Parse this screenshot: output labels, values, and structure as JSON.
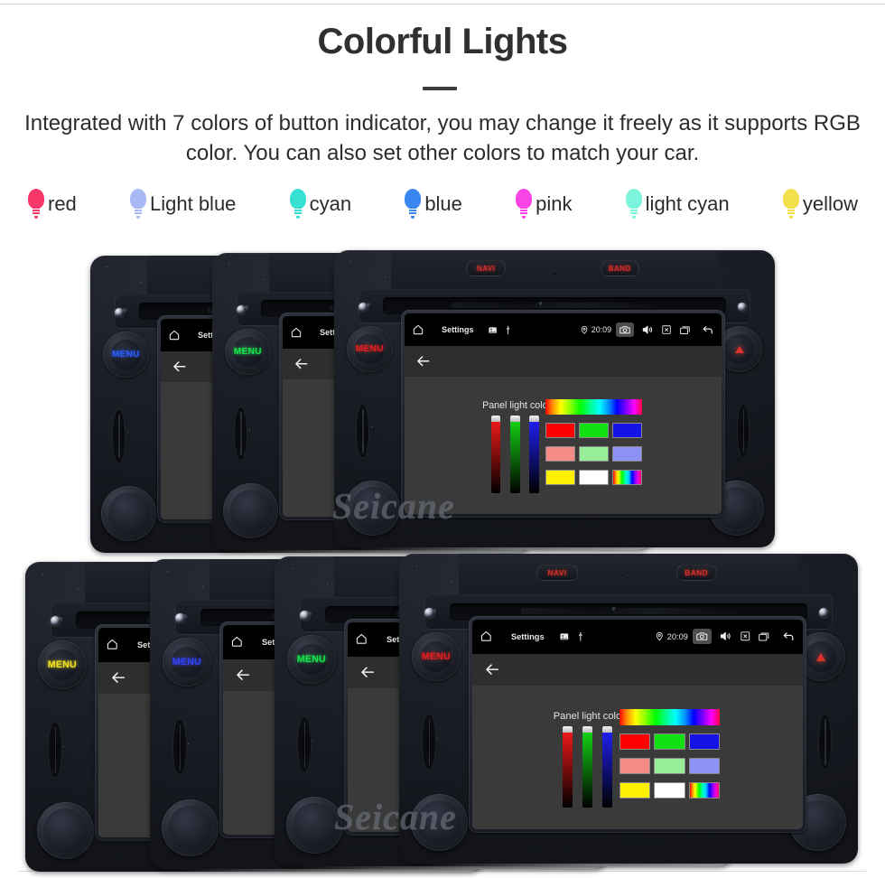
{
  "header": {
    "title": "Colorful Lights",
    "subtitle": "Integrated with 7 colors of button indicator, you may change it freely as it supports RGB color. You can also set other colors to match your car.",
    "divider_color": "#3c3d3f",
    "title_color": "#2f3032"
  },
  "legend": {
    "items": [
      {
        "label": "red",
        "color": "#f7386a"
      },
      {
        "label": "Light blue",
        "color": "#a7b9f4"
      },
      {
        "label": "cyan",
        "color": "#36e0d2"
      },
      {
        "label": "blue",
        "color": "#3a86f0"
      },
      {
        "label": "pink",
        "color": "#f945e6"
      },
      {
        "label": "light cyan",
        "color": "#7df4dc"
      },
      {
        "label": "yellow",
        "color": "#f2e04a"
      }
    ]
  },
  "device": {
    "brand_watermark": "Seicane",
    "front_buttons": {
      "navi": "NAVI",
      "band": "BAND"
    },
    "menu_knob_label": "MENU",
    "hazard_icon": "hazard-triangle-icon",
    "screen": {
      "statusbar": {
        "home_icon": "home-icon",
        "title": "Settings",
        "gallery_icon": "gallery-icon",
        "usb_icon": "usb-icon",
        "location_icon": "location-pin-icon",
        "time": "20:09",
        "camera_icon": "camera-icon",
        "volume_icon": "volume-icon",
        "close_icon": "close-box-icon",
        "recents_icon": "recents-icon",
        "back_icon": "back-arrow-icon"
      },
      "actionbar": {
        "back_icon": "back-arrow-icon"
      },
      "panel": {
        "label": "Panel light color",
        "sliders": [
          {
            "name": "red-slider",
            "color": "#ff1a1a",
            "value": 100
          },
          {
            "name": "green-slider",
            "color": "#15e015",
            "value": 100
          },
          {
            "name": "blue-slider",
            "color": "#2222ff",
            "value": 100
          }
        ],
        "hue_bar": "hue-gradient",
        "swatches": [
          [
            {
              "name": "red",
              "color": "#ff0000"
            },
            {
              "name": "green",
              "color": "#12e012"
            },
            {
              "name": "blue",
              "color": "#1414e8"
            }
          ],
          [
            {
              "name": "salmon",
              "color": "#f58b85"
            },
            {
              "name": "light-green",
              "color": "#97ee97"
            },
            {
              "name": "periwinkle",
              "color": "#8f92f5"
            }
          ],
          [
            {
              "name": "yellow",
              "color": "#ffef00"
            },
            {
              "name": "white",
              "color": "#ffffff"
            },
            {
              "name": "rainbow",
              "color": "rainbow"
            }
          ]
        ]
      }
    }
  },
  "rows": [
    {
      "name": "top-row",
      "units": [
        {
          "name": "unit-1",
          "menu_color": "#2b5bf5"
        },
        {
          "name": "unit-2",
          "menu_color": "#18e04a"
        },
        {
          "name": "unit-3",
          "menu_color": "#e02020"
        }
      ]
    },
    {
      "name": "bottom-row",
      "units": [
        {
          "name": "unit-1",
          "menu_color": "#f0e020"
        },
        {
          "name": "unit-2",
          "menu_color": "#3340f5"
        },
        {
          "name": "unit-3",
          "menu_color": "#18e04a"
        },
        {
          "name": "unit-4",
          "menu_color": "#e02020"
        }
      ]
    }
  ]
}
